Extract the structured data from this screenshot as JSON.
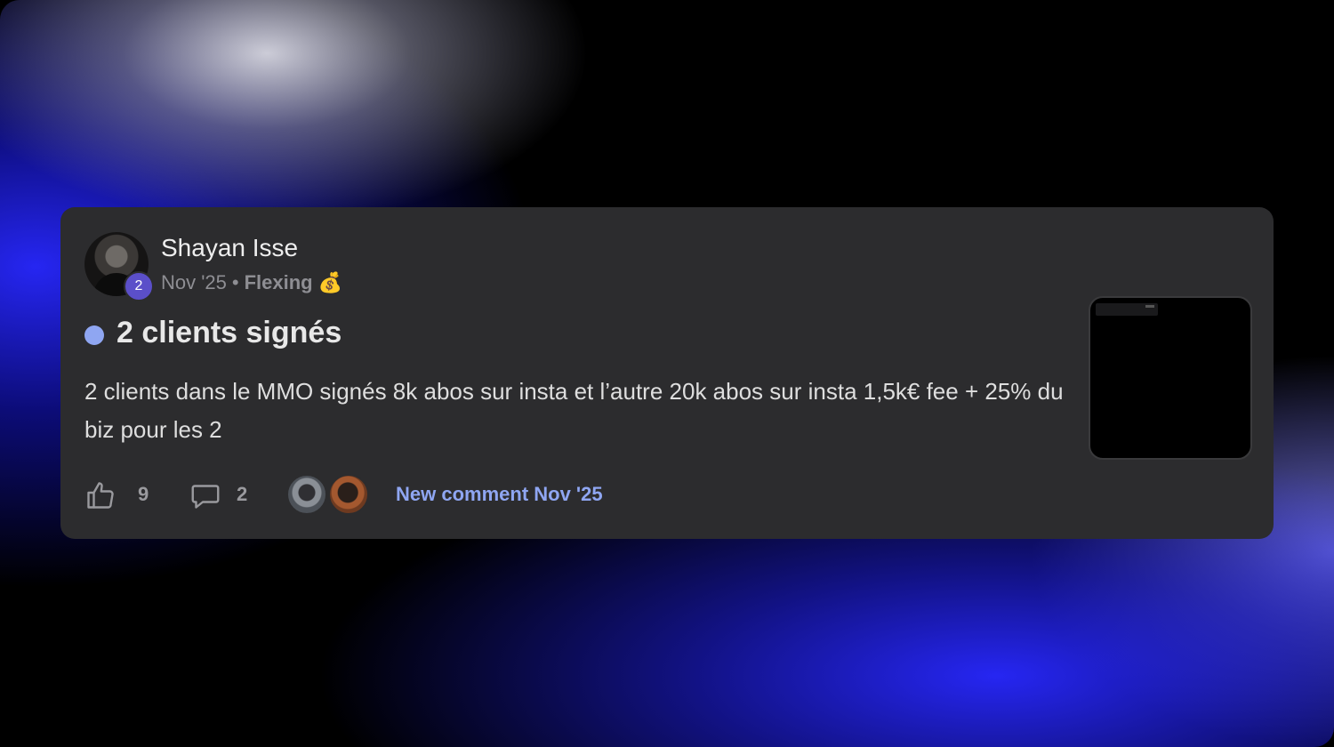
{
  "post": {
    "author": "Shayan Isse",
    "author_level": "2",
    "date": "Nov '25",
    "separator": "•",
    "category": "Flexing",
    "category_emoji": "💰",
    "title": "2 clients signés",
    "body": "2 clients dans le MMO signés 8k abos sur insta et l’autre 20k abos sur insta 1,5k€ fee + 25% du biz pour les 2",
    "unread_dot_color": "#8fa6f2"
  },
  "footer": {
    "likes": "9",
    "comments": "2",
    "new_comment_label": "New comment Nov '25",
    "commenter_avatars": [
      "avatar-1",
      "avatar-2"
    ]
  },
  "icons": {
    "like": "thumbs-up-icon",
    "comment": "speech-bubble-icon"
  },
  "colors": {
    "card_bg": "#2c2c2e",
    "accent": "#8fa6f2",
    "level_badge": "#5b4fc9"
  }
}
